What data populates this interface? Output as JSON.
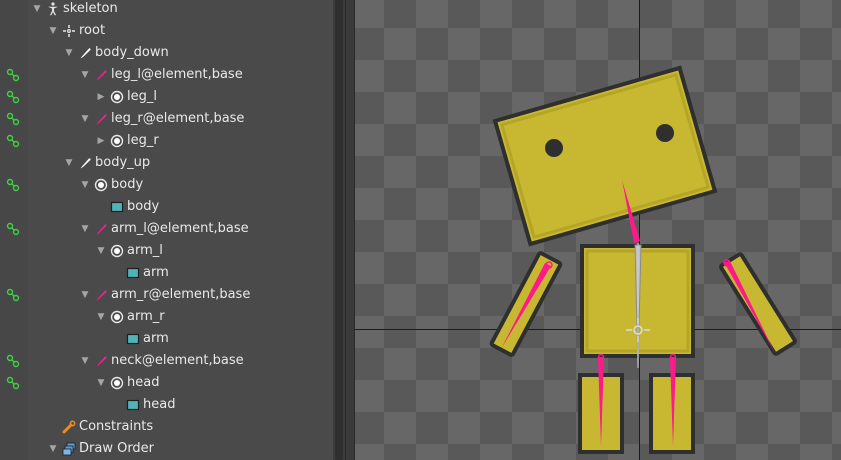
{
  "tree": {
    "rows": [
      {
        "label": "skeleton",
        "icon": "skeleton-icon",
        "depth": 0,
        "expanded": true,
        "link": false
      },
      {
        "label": "root",
        "icon": "root-bone-icon",
        "depth": 1,
        "expanded": true,
        "link": false
      },
      {
        "label": "body_down",
        "icon": "bone-icon",
        "depth": 2,
        "expanded": true,
        "link": false
      },
      {
        "label": "leg_l@element,base",
        "icon": "bone-icon",
        "depth": 3,
        "expanded": true,
        "link": true
      },
      {
        "label": "leg_l",
        "icon": "slot-icon",
        "depth": 4,
        "expanded": false,
        "link": true
      },
      {
        "label": "leg_r@element,base",
        "icon": "bone-icon",
        "depth": 3,
        "expanded": true,
        "link": true
      },
      {
        "label": "leg_r",
        "icon": "slot-icon",
        "depth": 4,
        "expanded": false,
        "link": true
      },
      {
        "label": "body_up",
        "icon": "bone-icon",
        "depth": 2,
        "expanded": true,
        "link": false
      },
      {
        "label": "body",
        "icon": "slot-icon",
        "depth": 3,
        "expanded": true,
        "link": true
      },
      {
        "label": "body",
        "icon": "image-icon",
        "depth": 4,
        "expanded": null,
        "link": false
      },
      {
        "label": "arm_l@element,base",
        "icon": "bone-icon",
        "depth": 3,
        "expanded": true,
        "link": true
      },
      {
        "label": "arm_l",
        "icon": "slot-icon",
        "depth": 4,
        "expanded": true,
        "link": false
      },
      {
        "label": "arm",
        "icon": "image-icon",
        "depth": 5,
        "expanded": null,
        "link": false
      },
      {
        "label": "arm_r@element,base",
        "icon": "bone-icon",
        "depth": 3,
        "expanded": true,
        "link": true
      },
      {
        "label": "arm_r",
        "icon": "slot-icon",
        "depth": 4,
        "expanded": true,
        "link": false
      },
      {
        "label": "arm",
        "icon": "image-icon",
        "depth": 5,
        "expanded": null,
        "link": false
      },
      {
        "label": "neck@element,base",
        "icon": "bone-icon",
        "depth": 3,
        "expanded": true,
        "link": true
      },
      {
        "label": "head",
        "icon": "slot-icon",
        "depth": 4,
        "expanded": true,
        "link": true
      },
      {
        "label": "head",
        "icon": "image-icon",
        "depth": 5,
        "expanded": null,
        "link": false
      },
      {
        "label": "Constraints",
        "icon": "constraints-icon",
        "depth": 1,
        "expanded": null,
        "link": false
      },
      {
        "label": "Draw Order",
        "icon": "draw-order-icon",
        "depth": 1,
        "expanded": true,
        "link": false
      }
    ]
  },
  "colors": {
    "bone": "#ff1a8c",
    "bone_white": "#ffffff",
    "attachment_fill": "#c8b831",
    "attachment_stroke": "#2f2f2f",
    "link": "#3fd23f",
    "image_icon": "#4fb3b8",
    "constraints_icon": "#f08a1c",
    "draw_order_icon": "#5b9bd8"
  }
}
